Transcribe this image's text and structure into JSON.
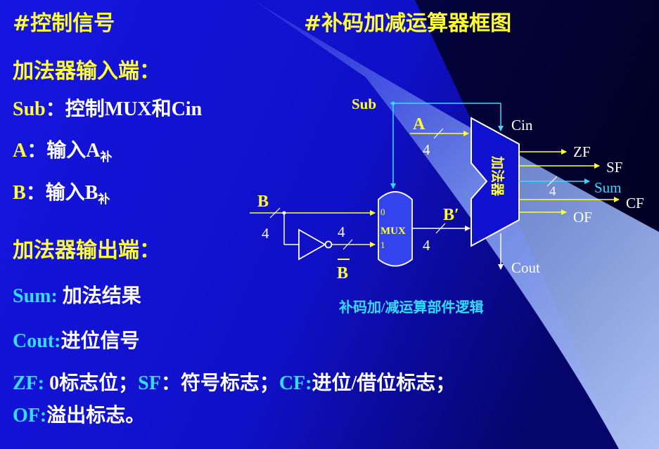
{
  "header": {
    "left_title": "#控制信号",
    "right_title": "#补码加减运算器框图"
  },
  "inputs_section": {
    "heading": "加法器输入端：",
    "sub_key": "Sub",
    "sub_desc": "：控制MUX和Cin",
    "a_key": "A",
    "a_desc": "：输入A",
    "a_subscript": "补",
    "b_key": "B",
    "b_desc": "：输入B",
    "b_subscript": "补"
  },
  "outputs_section": {
    "heading": "加法器输出端：",
    "sum_key": "Sum:",
    "sum_desc": " 加法结果",
    "cout_key": "Cout:",
    "cout_desc": "进位信号",
    "zf_key": "ZF:",
    "zf_desc": " 0标志位；",
    "sf_key": "SF",
    "sf_desc": "：符号标志；",
    "cf_key": "CF:",
    "cf_desc": "进位/借位标志；",
    "of_key": "OF:",
    "of_desc": "溢出标志。"
  },
  "diagram": {
    "caption": "补码加/减运算部件逻辑",
    "labels": {
      "sub": "Sub",
      "a": "A",
      "a_width": "4",
      "b": "B",
      "b_width": "4",
      "not_width": "4",
      "b_bar": "B",
      "mux": "MUX",
      "mux_in0": "0",
      "mux_in1": "1",
      "b_prime": "B′",
      "mux_out_width": "4",
      "cin": "Cin",
      "adder": "加法器",
      "cout": "Cout",
      "zf": "ZF",
      "sf": "SF",
      "sum": "Sum",
      "sum_width": "4",
      "cf": "CF",
      "of": "OF"
    }
  },
  "colors": {
    "background": "#1010d8",
    "yellow": "#ffff33",
    "cyan": "#33ddff",
    "white": "#ffffff",
    "mux_fill": "#3344ee"
  }
}
